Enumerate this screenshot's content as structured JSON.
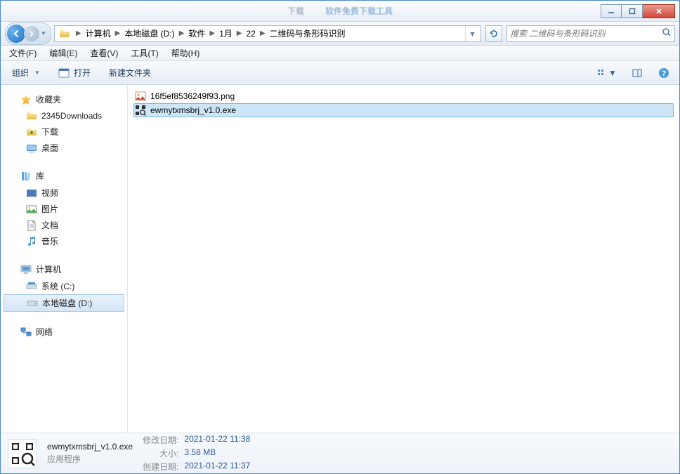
{
  "titlebar": {
    "blurred_left": "下载",
    "blurred_right": "软件免费下载工具"
  },
  "nav": {
    "crumbs": [
      "计算机",
      "本地磁盘 (D:)",
      "软件",
      "1月",
      "22",
      "二维码与条形码识别"
    ],
    "search_placeholder": "搜索 二维码与条形码识别"
  },
  "menu": {
    "file": "文件(F)",
    "edit": "编辑(E)",
    "view": "查看(V)",
    "tools": "工具(T)",
    "help": "帮助(H)"
  },
  "toolbar": {
    "organize": "组织",
    "open": "打开",
    "newfolder": "新建文件夹"
  },
  "sidebar": {
    "favorites": {
      "label": "收藏夹",
      "items": [
        "2345Downloads",
        "下载",
        "桌面"
      ]
    },
    "libraries": {
      "label": "库",
      "items": [
        "视频",
        "图片",
        "文档",
        "音乐"
      ]
    },
    "computer": {
      "label": "计算机",
      "items": [
        "系统 (C:)",
        "本地磁盘 (D:)"
      ]
    },
    "network": {
      "label": "网络"
    }
  },
  "files": [
    {
      "name": "16f5ef8536249f93.png",
      "type": "png"
    },
    {
      "name": "ewmytxmsbrj_v1.0.exe",
      "type": "exe",
      "selected": true
    }
  ],
  "details": {
    "name": "ewmytxmsbrj_v1.0.exe",
    "type": "应用程序",
    "mod_label": "修改日期:",
    "mod_val": "2021-01-22 11:38",
    "size_label": "大小:",
    "size_val": "3.58 MB",
    "created_label": "创建日期:",
    "created_val": "2021-01-22 11:37"
  }
}
